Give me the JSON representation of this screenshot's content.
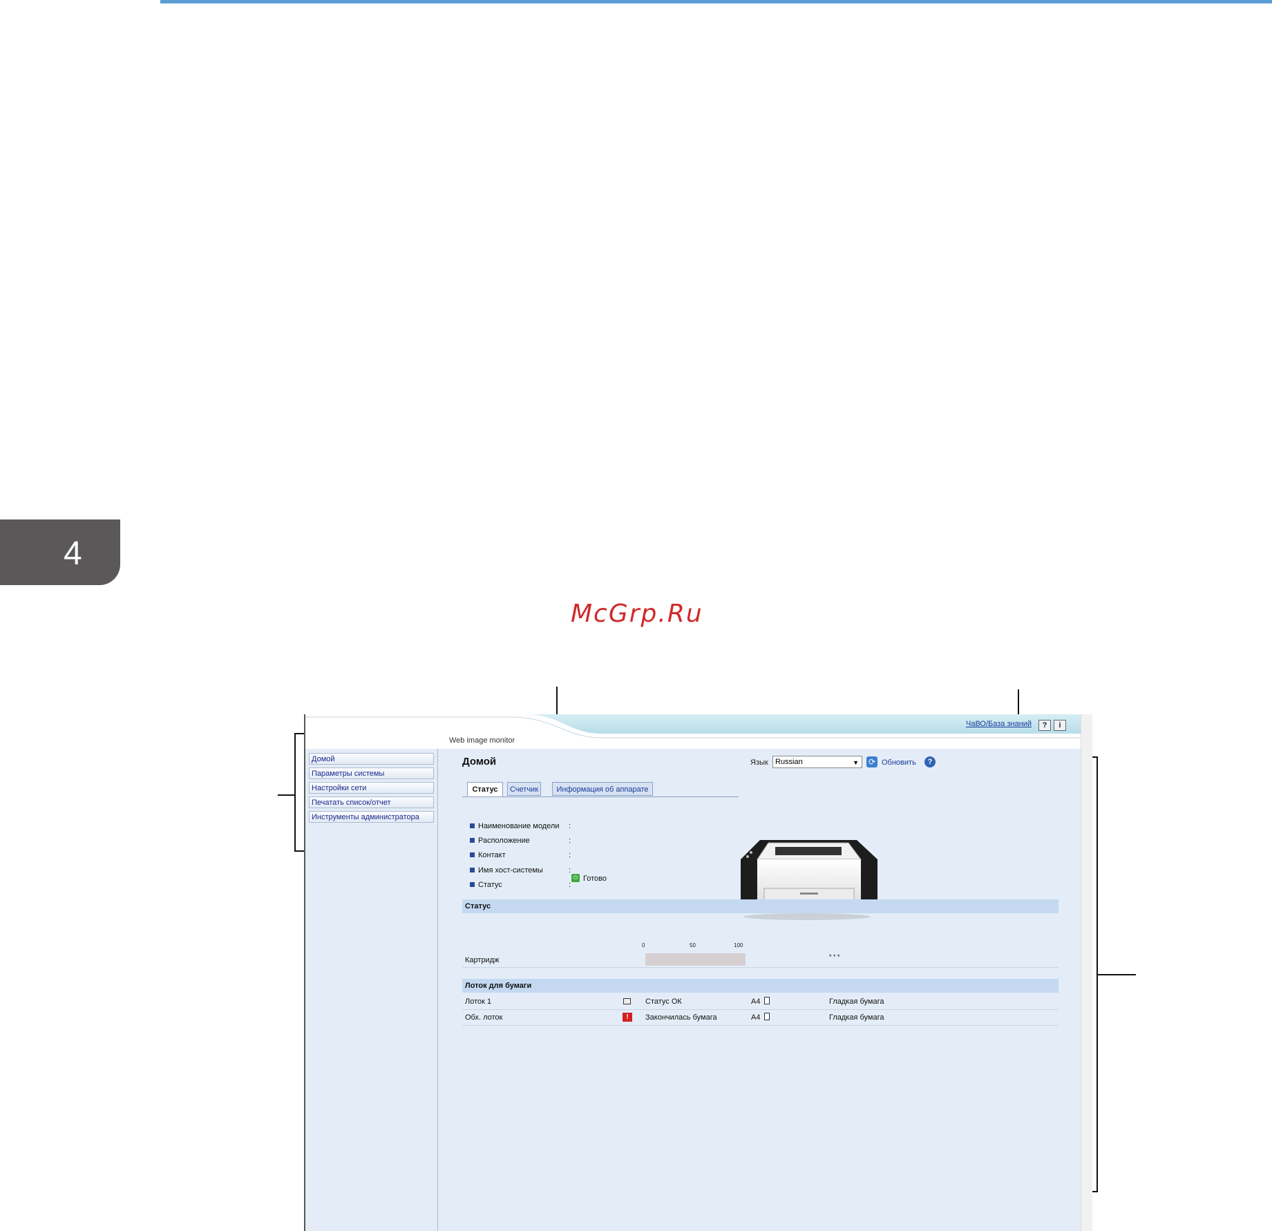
{
  "chapter": {
    "number": "4"
  },
  "watermark": "McGrp.Ru",
  "app": {
    "title": "Web image monitor",
    "faq_link": "ЧаВО/База знаний",
    "help_btn": "?",
    "info_btn": "i"
  },
  "nav": {
    "items": [
      {
        "label": "Домой"
      },
      {
        "label": "Параметры системы"
      },
      {
        "label": "Настройки сети"
      },
      {
        "label": "Печатать список/отчет"
      },
      {
        "label": "Инструменты администратора"
      }
    ]
  },
  "main": {
    "title": "Домой",
    "language_label": "Язык",
    "language_value": "Russian",
    "refresh_label": "Обновить",
    "tabs": [
      {
        "label": "Статус"
      },
      {
        "label": "Счетчик"
      },
      {
        "label": "Информация об аппарате"
      }
    ],
    "info": [
      {
        "label": "Наименование модели",
        "value": ":"
      },
      {
        "label": "Расположение",
        "value": ":"
      },
      {
        "label": "Контакт",
        "value": ":"
      },
      {
        "label": "Имя хост-системы",
        "value": ":"
      },
      {
        "label": "Статус",
        "value": ":"
      }
    ],
    "status_value": "Готово",
    "status_section": {
      "title": "Статус",
      "scale": [
        "0",
        "50",
        "100"
      ],
      "cartridge_label": "Картридж",
      "cartridge_value": "* * *",
      "cartridge_level_percent": 100
    },
    "tray_section": {
      "title": "Лоток для бумаги",
      "rows": [
        {
          "name": "Лоток 1",
          "status": "Статус ОК",
          "size": "A4",
          "type": "Гладкая бумага",
          "state": "ok"
        },
        {
          "name": "Обх. лоток",
          "status": "Закончилась бумага",
          "size": "A4",
          "type": "Гладкая бумага",
          "state": "error"
        }
      ]
    }
  }
}
